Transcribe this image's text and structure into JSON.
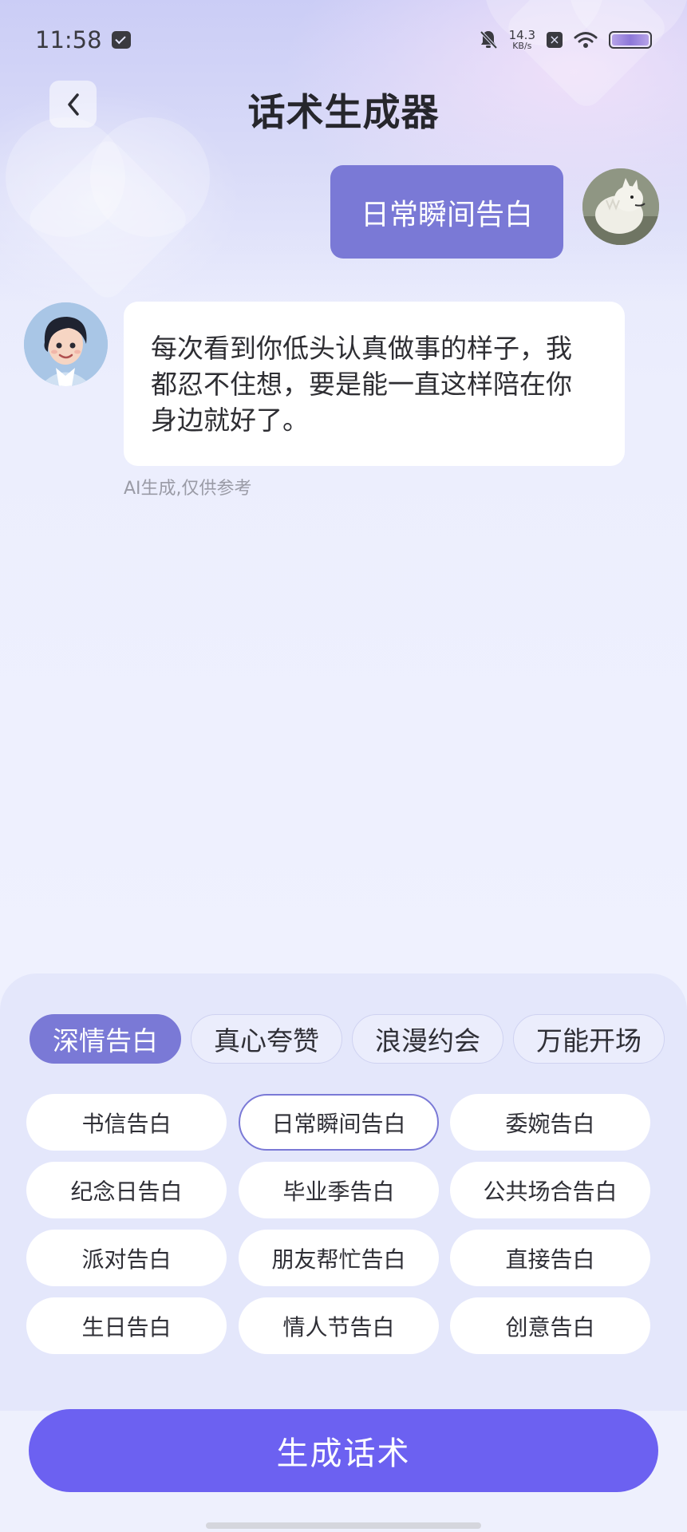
{
  "status_bar": {
    "time": "11:58",
    "net_speed_value": "14.3",
    "net_speed_unit": "KB/s",
    "icons": [
      "message-icon",
      "bell-off-icon",
      "close-box-icon",
      "wifi-icon",
      "battery-icon"
    ]
  },
  "header": {
    "title": "话术生成器",
    "back_icon": "chevron-left-icon"
  },
  "chat": {
    "user_message": "日常瞬间告白",
    "bot_message": "每次看到你低头认真做事的样子，我都忍不住想，要是能一直这样陪在你身边就好了。",
    "ai_note": "AI生成,仅供参考"
  },
  "categories": {
    "tabs": [
      {
        "label": "深情告白",
        "active": true
      },
      {
        "label": "真心夸赞",
        "active": false
      },
      {
        "label": "浪漫约会",
        "active": false
      },
      {
        "label": "万能开场",
        "active": false
      }
    ],
    "options": [
      {
        "label": "书信告白",
        "selected": false
      },
      {
        "label": "日常瞬间告白",
        "selected": true
      },
      {
        "label": "委婉告白",
        "selected": false
      },
      {
        "label": "纪念日告白",
        "selected": false
      },
      {
        "label": "毕业季告白",
        "selected": false
      },
      {
        "label": "公共场合告白",
        "selected": false
      },
      {
        "label": "派对告白",
        "selected": false
      },
      {
        "label": "朋友帮忙告白",
        "selected": false
      },
      {
        "label": "直接告白",
        "selected": false
      },
      {
        "label": "生日告白",
        "selected": false
      },
      {
        "label": "情人节告白",
        "selected": false
      },
      {
        "label": "创意告白",
        "selected": false
      }
    ]
  },
  "actions": {
    "generate_label": "生成话术"
  },
  "colors": {
    "accent": "#7a79d6",
    "button": "#6c61f1"
  }
}
